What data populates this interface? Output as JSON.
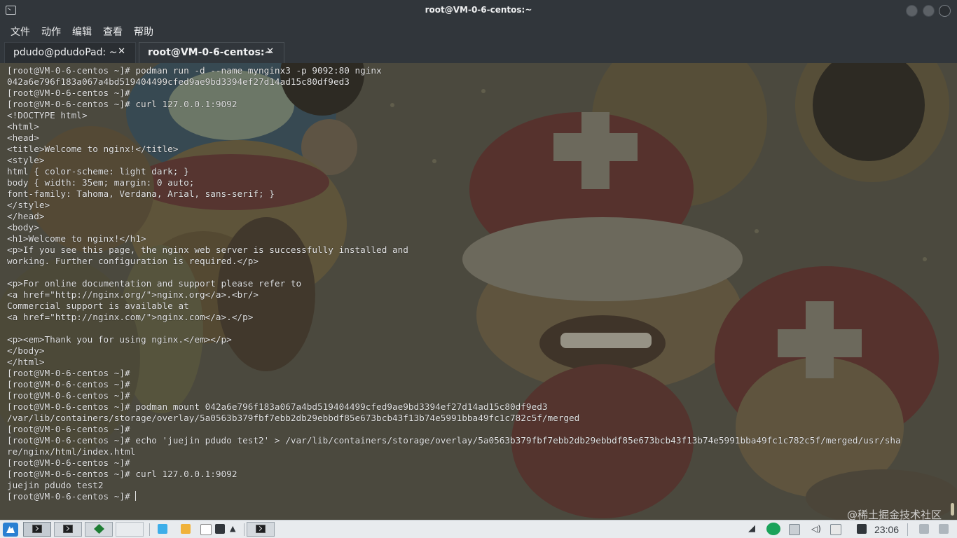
{
  "window": {
    "title": "root@VM-0-6-centos:~"
  },
  "menu": [
    "文件",
    "动作",
    "编辑",
    "查看",
    "帮助"
  ],
  "tabs": [
    {
      "label": "pdudo@pdudoPad: ~",
      "close": "✕",
      "active": false
    },
    {
      "label": "root@VM-0-6-centos:~",
      "close": "✕",
      "active": true
    }
  ],
  "terminal": {
    "lines": [
      "[root@VM-0-6-centos ~]# podman run -d --name mynginx3 -p 9092:80 nginx",
      "042a6e796f183a067a4bd519404499cfed9ae9bd3394ef27d14ad15c80df9ed3",
      "[root@VM-0-6-centos ~]#",
      "[root@VM-0-6-centos ~]# curl 127.0.0.1:9092",
      "<!DOCTYPE html>",
      "<html>",
      "<head>",
      "<title>Welcome to nginx!</title>",
      "<style>",
      "html { color-scheme: light dark; }",
      "body { width: 35em; margin: 0 auto;",
      "font-family: Tahoma, Verdana, Arial, sans-serif; }",
      "</style>",
      "</head>",
      "<body>",
      "<h1>Welcome to nginx!</h1>",
      "<p>If you see this page, the nginx web server is successfully installed and",
      "working. Further configuration is required.</p>",
      "",
      "<p>For online documentation and support please refer to",
      "<a href=\"http://nginx.org/\">nginx.org</a>.<br/>",
      "Commercial support is available at",
      "<a href=\"http://nginx.com/\">nginx.com</a>.</p>",
      "",
      "<p><em>Thank you for using nginx.</em></p>",
      "</body>",
      "</html>",
      "[root@VM-0-6-centos ~]#",
      "[root@VM-0-6-centos ~]#",
      "[root@VM-0-6-centos ~]#",
      "[root@VM-0-6-centos ~]# podman mount 042a6e796f183a067a4bd519404499cfed9ae9bd3394ef27d14ad15c80df9ed3",
      "/var/lib/containers/storage/overlay/5a0563b379fbf7ebb2db29ebbdf85e673bcb43f13b74e5991bba49fc1c782c5f/merged",
      "[root@VM-0-6-centos ~]#",
      "[root@VM-0-6-centos ~]# echo 'juejin pdudo test2' > /var/lib/containers/storage/overlay/5a0563b379fbf7ebb2db29ebbdf85e673bcb43f13b74e5991bba49fc1c782c5f/merged/usr/sha",
      "re/nginx/html/index.html",
      "[root@VM-0-6-centos ~]#",
      "[root@VM-0-6-centos ~]# curl 127.0.0.1:9092",
      "juejin pdudo test2"
    ],
    "prompt": "[root@VM-0-6-centos ~]# "
  },
  "watermark": "@稀土掘金技术社区",
  "taskbar": {
    "clock": "23:06",
    "colors": {
      "launcher": "#2a80d2",
      "vim": "#1e7d33",
      "accent": "#3daee9"
    }
  }
}
